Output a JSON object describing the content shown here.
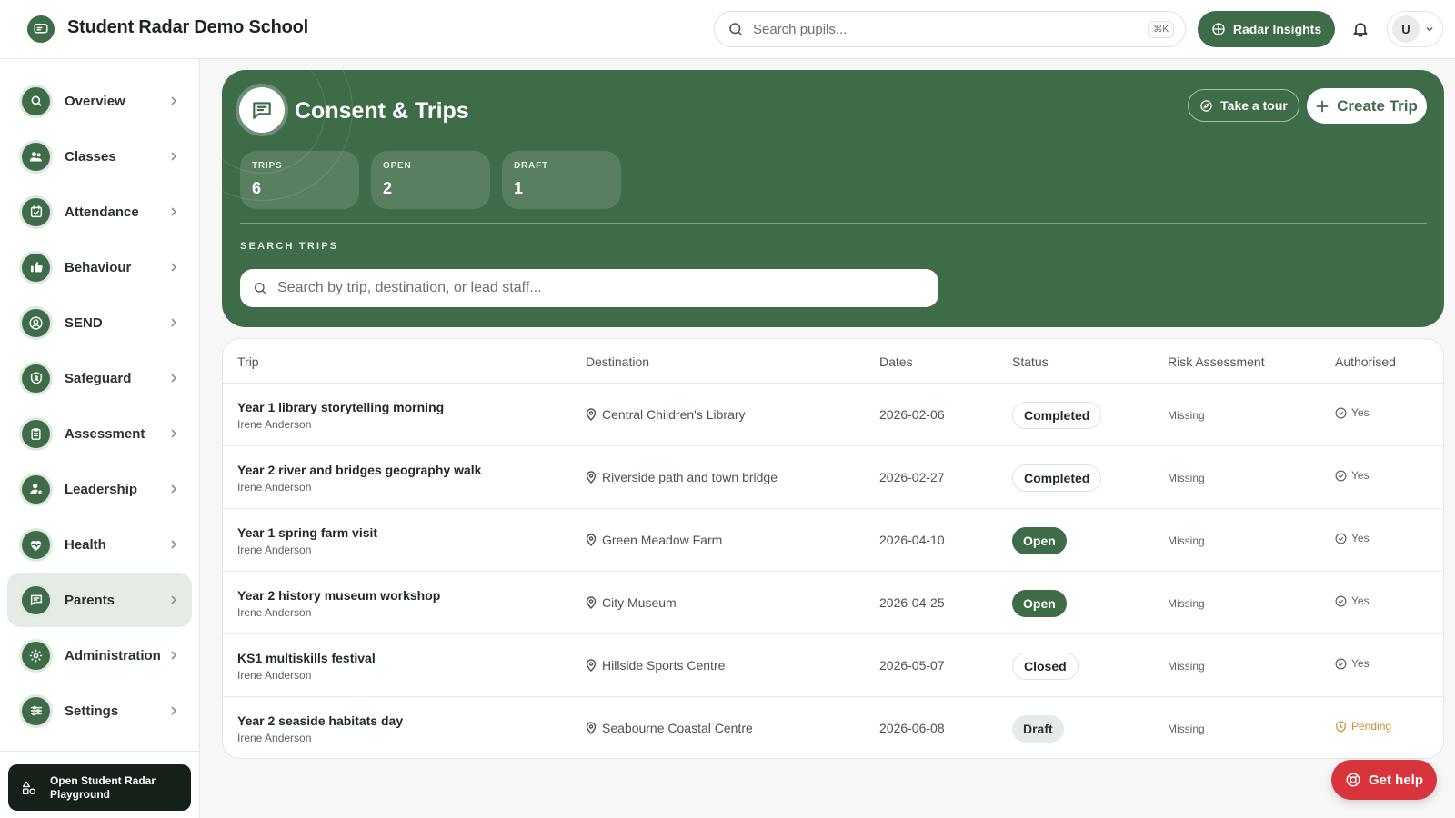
{
  "header": {
    "school_name": "Student Radar Demo School",
    "search_placeholder": "Search pupils...",
    "search_shortcut": "⌘K",
    "insights_label": "Radar Insights",
    "user_initial": "U"
  },
  "sidebar": {
    "items": [
      {
        "label": "Overview",
        "icon": "search-icon"
      },
      {
        "label": "Classes",
        "icon": "users-icon"
      },
      {
        "label": "Attendance",
        "icon": "calendar-check-icon"
      },
      {
        "label": "Behaviour",
        "icon": "thumbs-up-icon"
      },
      {
        "label": "SEND",
        "icon": "user-circle-icon"
      },
      {
        "label": "Safeguard",
        "icon": "shield-icon"
      },
      {
        "label": "Assessment",
        "icon": "clipboard-icon"
      },
      {
        "label": "Leadership",
        "icon": "user-star-icon"
      },
      {
        "label": "Health",
        "icon": "heart-pulse-icon"
      },
      {
        "label": "Parents",
        "icon": "message-icon",
        "active": true
      },
      {
        "label": "Administration",
        "icon": "gear-icon"
      },
      {
        "label": "Settings",
        "icon": "sliders-icon"
      }
    ],
    "playground_label": "Open Student Radar Playground"
  },
  "hero": {
    "title": "Consent & Trips",
    "tour_label": "Take a tour",
    "create_label": "Create Trip",
    "stats": [
      {
        "label": "TRIPS",
        "value": "6"
      },
      {
        "label": "OPEN",
        "value": "2"
      },
      {
        "label": "DRAFT",
        "value": "1"
      }
    ],
    "search_label": "SEARCH TRIPS",
    "search_placeholder": "Search by trip, destination, or lead staff..."
  },
  "table": {
    "columns": [
      "Trip",
      "Destination",
      "Dates",
      "Status",
      "Risk Assessment",
      "Authorised"
    ],
    "rows": [
      {
        "trip": "Year 1 library storytelling morning",
        "lead": "Irene Anderson",
        "destination": "Central Children's Library",
        "date": "2026-02-06",
        "status": "Completed",
        "risk": "Missing",
        "authorised": "Yes"
      },
      {
        "trip": "Year 2 river and bridges geography walk",
        "lead": "Irene Anderson",
        "destination": "Riverside path and town bridge",
        "date": "2026-02-27",
        "status": "Completed",
        "risk": "Missing",
        "authorised": "Yes"
      },
      {
        "trip": "Year 1 spring farm visit",
        "lead": "Irene Anderson",
        "destination": "Green Meadow Farm",
        "date": "2026-04-10",
        "status": "Open",
        "risk": "Missing",
        "authorised": "Yes"
      },
      {
        "trip": "Year 2 history museum workshop",
        "lead": "Irene Anderson",
        "destination": "City Museum",
        "date": "2026-04-25",
        "status": "Open",
        "risk": "Missing",
        "authorised": "Yes"
      },
      {
        "trip": "KS1 multiskills festival",
        "lead": "Irene Anderson",
        "destination": "Hillside Sports Centre",
        "date": "2026-05-07",
        "status": "Closed",
        "risk": "Missing",
        "authorised": "Yes"
      },
      {
        "trip": "Year 2 seaside habitats day",
        "lead": "Irene Anderson",
        "destination": "Seabourne Coastal Centre",
        "date": "2026-06-08",
        "status": "Draft",
        "risk": "Missing",
        "authorised": "Pending"
      }
    ]
  },
  "help": {
    "label": "Get help"
  },
  "colors": {
    "brand": "#3e6b48",
    "help": "#d9343b",
    "pending": "#d18a2c"
  }
}
